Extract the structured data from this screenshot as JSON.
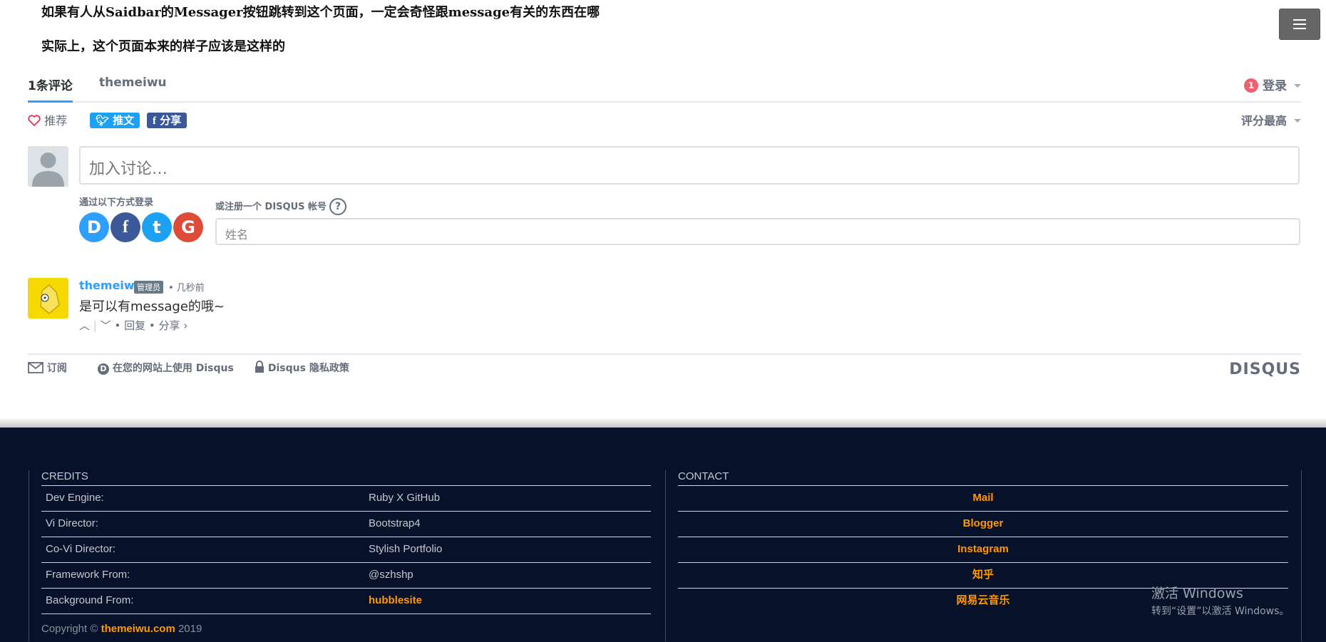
{
  "post": {
    "line1": "如果有人从Saidbar的Messager按钮跳转到这个页面，一定会奇怪跟message有关的东西在哪",
    "line2": "实际上，这个页面本来的样子应该是这样的"
  },
  "menu_button": {
    "icon": "hamburger-icon"
  },
  "disqus": {
    "tab_comments": "1条评论",
    "tab_site": "themeiwu",
    "notification_count": "1",
    "login_label": "登录",
    "recommend_label": "推荐",
    "tweet_label": "推文",
    "share_label": "分享",
    "sort_label": "评分最高",
    "compose_placeholder": "加入讨论…",
    "login_with_label": "通过以下方式登录",
    "signup_label": "或注册一个 DISQUS 帐号",
    "help_glyph": "?",
    "name_placeholder": "姓名",
    "social": [
      {
        "name": "disqus",
        "glyph": "D",
        "color": "#2e9fff"
      },
      {
        "name": "facebook",
        "glyph": "f",
        "color": "#3b5998"
      },
      {
        "name": "twitter",
        "glyph": "t",
        "color": "#1da1f2"
      },
      {
        "name": "google",
        "glyph": "G",
        "color": "#dd4b39"
      }
    ],
    "comment": {
      "author": "themeiwu",
      "badge": "管理员",
      "time": "• 几秒前",
      "body": "是可以有message的哦~",
      "reply_label": "回复",
      "share_label": "分享 ›"
    },
    "footer": {
      "subscribe": "订阅",
      "use_disqus": "在您的网站上使用 Disqus",
      "privacy": "Disqus 隐私政策",
      "logo": "DISQUS"
    },
    "colors": {
      "accent": "#2e9fff",
      "notification": "#f05f70",
      "twitter": "#1da1f2",
      "facebook": "#3b5998"
    }
  },
  "site_footer": {
    "credits_title": "CREDITS",
    "credits": [
      {
        "key": "Dev Engine:",
        "value": "Ruby X GitHub"
      },
      {
        "key": "Vi Director:",
        "value": "Bootstrap4"
      },
      {
        "key": "Co-Vi Director:",
        "value": "Stylish Portfolio"
      },
      {
        "key": "Framework From:",
        "value": "@szhshp"
      },
      {
        "key": "Background From:",
        "value": "hubblesite"
      }
    ],
    "contact_title": "CONTACT",
    "contact": [
      "Mail",
      "Blogger",
      "Instagram",
      "知乎",
      "网易云音乐"
    ],
    "copyright_prefix": "Copyright ©",
    "copyright_link": "themeiwu.com",
    "copyright_year": "2019",
    "colors": {
      "background": "#07112a",
      "link": "#ff9900"
    }
  },
  "windows_watermark": {
    "title": "激活 Windows",
    "subtitle": "转到“设置”以激活 Windows。"
  }
}
